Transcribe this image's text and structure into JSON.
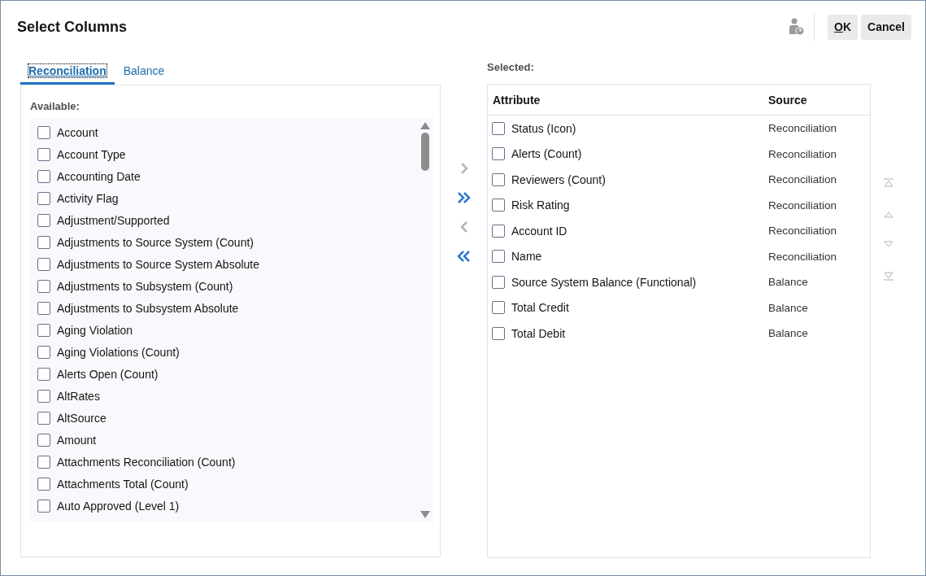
{
  "window": {
    "title": "Select Columns"
  },
  "header_buttons": [
    {
      "label": "OK",
      "mnemonic_underlined": true
    },
    {
      "label": "Cancel"
    }
  ],
  "tabs": [
    {
      "label": "Reconciliation",
      "selected": true
    },
    {
      "label": "Balance",
      "selected": false
    }
  ],
  "available": {
    "label": "Available:",
    "items": [
      {
        "label": "Account",
        "checked": false
      },
      {
        "label": "Account Type",
        "checked": false
      },
      {
        "label": "Accounting Date",
        "checked": false
      },
      {
        "label": "Activity Flag",
        "checked": false
      },
      {
        "label": "Adjustment/Supported",
        "checked": false
      },
      {
        "label": "Adjustments to Source System (Count)",
        "checked": false
      },
      {
        "label": "Adjustments to Source System Absolute",
        "checked": false
      },
      {
        "label": "Adjustments to Subsystem (Count)",
        "checked": false
      },
      {
        "label": "Adjustments to Subsystem Absolute",
        "checked": false
      },
      {
        "label": "Aging Violation",
        "checked": false
      },
      {
        "label": "Aging Violations (Count)",
        "checked": false
      },
      {
        "label": "Alerts Open (Count)",
        "checked": false
      },
      {
        "label": "AltRates",
        "checked": false
      },
      {
        "label": "AltSource",
        "checked": false
      },
      {
        "label": "Amount",
        "checked": false
      },
      {
        "label": "Attachments Reconciliation (Count)",
        "checked": false
      },
      {
        "label": "Attachments Total (Count)",
        "checked": false
      },
      {
        "label": "Auto Approved (Level 1)",
        "checked": false
      }
    ]
  },
  "move_buttons": [
    {
      "kind": "add",
      "disabled": true
    },
    {
      "kind": "add_all",
      "disabled": false
    },
    {
      "kind": "remove",
      "disabled": true
    },
    {
      "kind": "remove_all",
      "disabled": false
    }
  ],
  "selected": {
    "label": "Selected:",
    "columns": [
      "Attribute",
      "Source"
    ],
    "rows": [
      {
        "attribute": "Status (Icon)",
        "source": "Reconciliation",
        "checked": false
      },
      {
        "attribute": "Alerts (Count)",
        "source": "Reconciliation",
        "checked": false
      },
      {
        "attribute": "Reviewers (Count)",
        "source": "Reconciliation",
        "checked": false
      },
      {
        "attribute": "Risk Rating",
        "source": "Reconciliation",
        "checked": false
      },
      {
        "attribute": "Account ID",
        "source": "Reconciliation",
        "checked": false
      },
      {
        "attribute": "Name",
        "source": "Reconciliation",
        "checked": false
      },
      {
        "attribute": "Source System Balance (Functional)",
        "source": "Balance",
        "checked": false
      },
      {
        "attribute": "Total Credit",
        "source": "Balance",
        "checked": false
      },
      {
        "attribute": "Total Debit",
        "source": "Balance",
        "checked": false
      }
    ]
  },
  "order_buttons": [
    {
      "kind": "top",
      "disabled": true
    },
    {
      "kind": "up",
      "disabled": true
    },
    {
      "kind": "down",
      "disabled": true
    },
    {
      "kind": "bottom",
      "disabled": true
    }
  ]
}
